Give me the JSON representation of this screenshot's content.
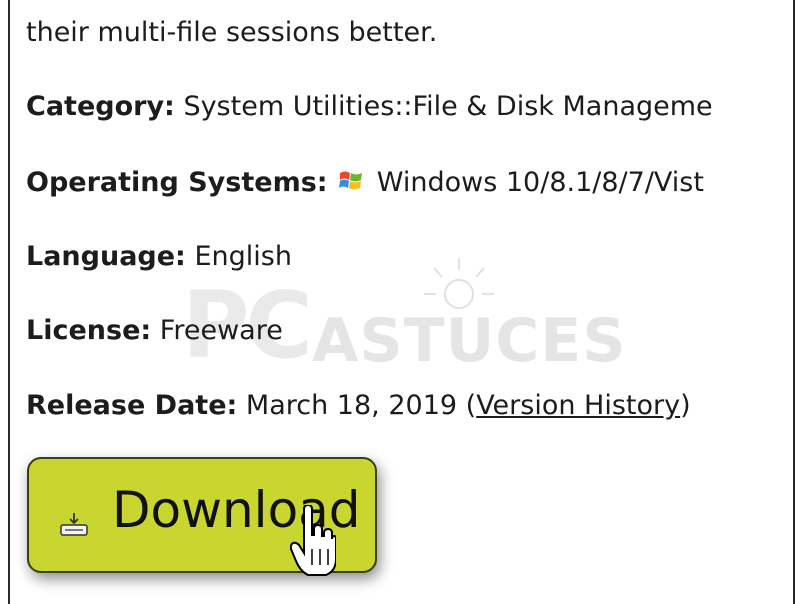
{
  "intro_text": "their multi-file sessions better.",
  "details": {
    "category": {
      "label": "Category:",
      "value": "System Utilities::File & Disk Manageme"
    },
    "os": {
      "label": "Operating Systems:",
      "icon": "windows-logo-icon",
      "value": "Windows 10/8.1/8/7/Vist"
    },
    "language": {
      "label": "Language:",
      "value": "English"
    },
    "license": {
      "label": "License:",
      "value": "Freeware"
    },
    "release": {
      "label": "Release Date:",
      "value": "March 18, 2019",
      "open_paren": "(",
      "link": "Version History",
      "close_paren": ")"
    }
  },
  "download_button": {
    "label": "Download",
    "icon": "download-tray-icon"
  },
  "watermark": {
    "pc": "PC",
    "astuces": "ASTUCES",
    "icon": "lightbulb-icon"
  },
  "cursor": {
    "icon": "hand-pointer-cursor-icon"
  },
  "colors": {
    "button_bg": "#c9d62f",
    "text": "#1c1c1c"
  }
}
